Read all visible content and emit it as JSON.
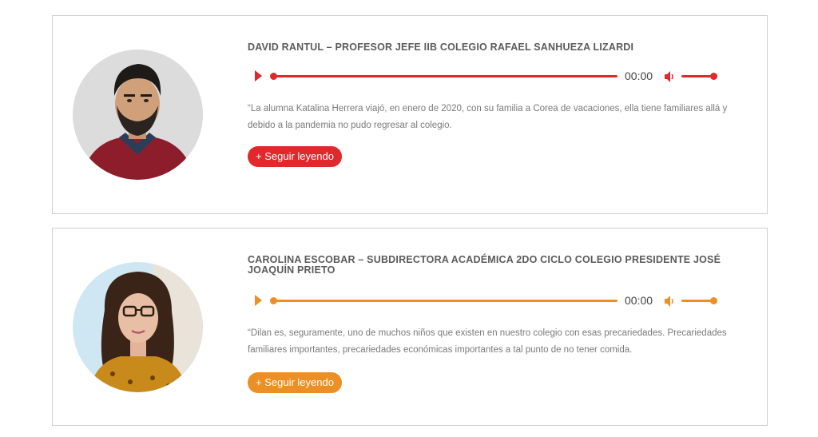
{
  "cards": [
    {
      "title": "DAVID RANTUL – PROFESOR JEFE IIB COLEGIO RAFAEL SANHUEZA LIZARDI",
      "accent_color": "#e0282d",
      "player": {
        "time": "00:00",
        "progress": 0,
        "volume": 1
      },
      "quote": "“La alumna Katalina Herrera viajó, en enero de 2020, con su familia a Corea de vacaciones, ella tiene familiares allá y debido a la pandemia no pudo regresar al colegio.",
      "button_label": "+ Seguir leyendo",
      "avatar_icon": "man-portrait"
    },
    {
      "title": "CAROLINA ESCOBAR – SUBDIRECTORA ACADÉMICA 2DO CICLO COLEGIO PRESIDENTE JOSÉ JOAQUÍN PRIETO",
      "accent_color": "#ec8f24",
      "player": {
        "time": "00:00",
        "progress": 0,
        "volume": 1
      },
      "quote": "“Dilan es, seguramente, uno de muchos niños que existen en nuestro colegio con esas precariedades. Precariedades familiares importantes, precariedades económicas importantes a tal punto de no tener comida.",
      "button_label": "+ Seguir leyendo",
      "avatar_icon": "woman-portrait"
    }
  ]
}
